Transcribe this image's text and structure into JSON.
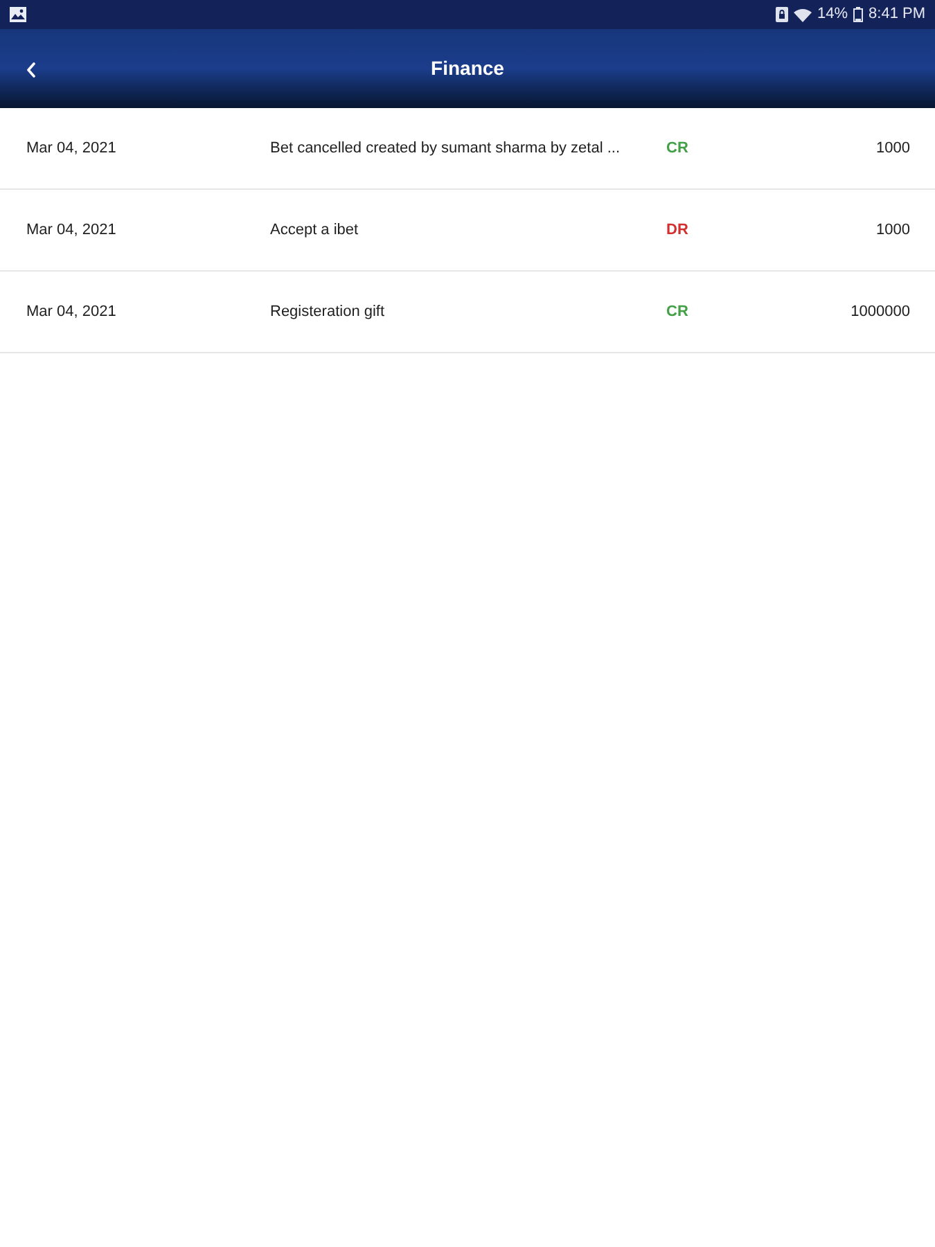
{
  "status_bar": {
    "battery": "14%",
    "time": "8:41 PM"
  },
  "app_bar": {
    "title": "Finance"
  },
  "transactions": [
    {
      "date": "Mar 04, 2021",
      "description": "Bet cancelled created by sumant sharma by zetal ...",
      "type": "CR",
      "color": "#43a047",
      "amount": "1000"
    },
    {
      "date": "Mar 04, 2021",
      "description": "Accept a ibet",
      "type": "DR",
      "color": "#d32f2f",
      "amount": "1000"
    },
    {
      "date": "Mar 04, 2021",
      "description": "Registeration gift",
      "type": "CR",
      "color": "#43a047",
      "amount": "1000000"
    }
  ]
}
